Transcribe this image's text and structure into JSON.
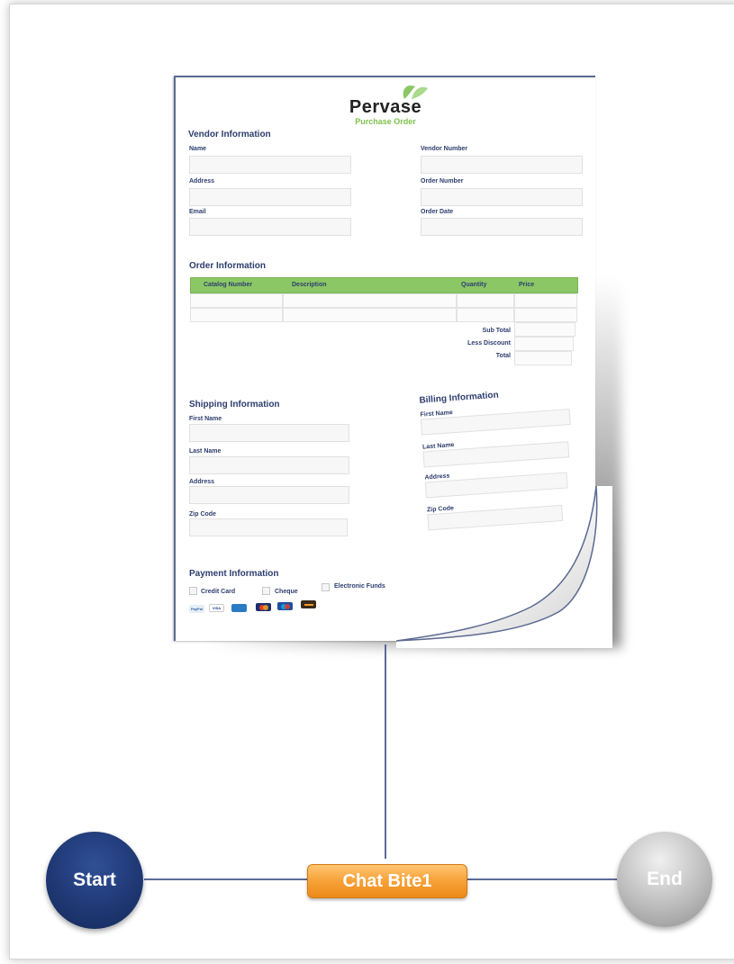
{
  "document": {
    "brand": "Pervase",
    "subtitle": "Purchase Order",
    "vendor": {
      "title": "Vendor Information",
      "name": "Name",
      "address": "Address",
      "email": "Email",
      "vendor_number": "Vendor Number",
      "order_number": "Order Number",
      "order_date": "Order Date"
    },
    "order": {
      "title": "Order Information",
      "columns": [
        "Catalog Number",
        "Description",
        "Quantity",
        "Price"
      ],
      "sub_total": "Sub Total",
      "less_discount": "Less Discount",
      "total": "Total"
    },
    "shipping": {
      "title": "Shipping Information",
      "first_name": "First Name",
      "last_name": "Last Name",
      "address": "Address",
      "zip": "Zip Code"
    },
    "billing": {
      "title": "Billing Information",
      "first_name": "First Name",
      "last_name": "Last Name",
      "address": "Address",
      "zip": "Zip Code"
    },
    "payment": {
      "title": "Payment Information",
      "options": [
        "Credit Card",
        "Cheque",
        "Electronic Funds"
      ],
      "cards": [
        "PayPal",
        "VISA"
      ]
    }
  },
  "flow": {
    "start": "Start",
    "chat": "Chat Bite1",
    "end": "End"
  },
  "colors": {
    "start": "#1d356f",
    "chat": "#f39a2b",
    "end": "#b5b5b5",
    "connector": "#5b6b98",
    "accent_green": "#8cc765"
  }
}
